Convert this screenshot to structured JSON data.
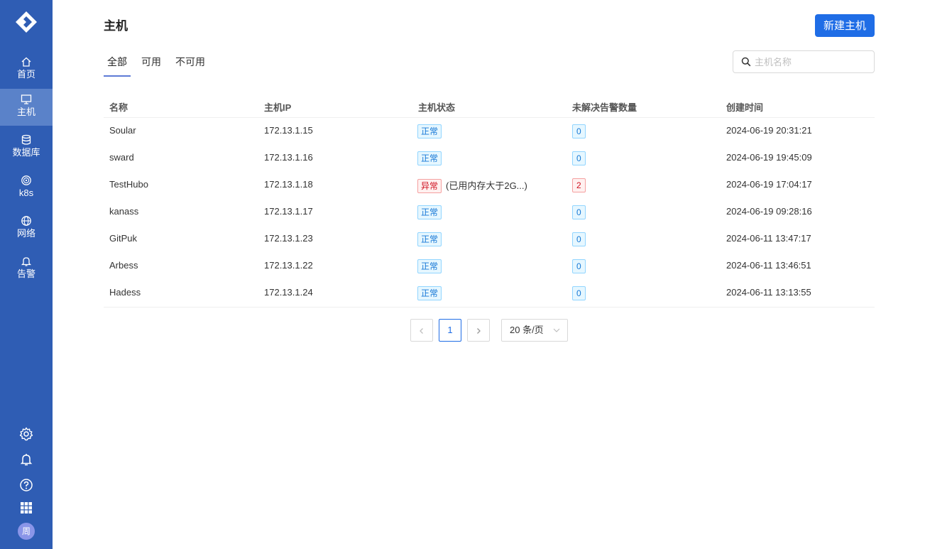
{
  "sidebar": {
    "items": [
      {
        "label": "首页",
        "icon": "home-icon"
      },
      {
        "label": "主机",
        "icon": "monitor-icon",
        "active": true
      },
      {
        "label": "数据库",
        "icon": "database-icon"
      },
      {
        "label": "k8s",
        "icon": "k8s-icon"
      },
      {
        "label": "网络",
        "icon": "globe-icon"
      },
      {
        "label": "告警",
        "icon": "bell-icon"
      }
    ],
    "bottom_icons": [
      "gear-icon",
      "bell-icon",
      "help-icon",
      "apps-grid-icon"
    ],
    "avatar_text": "周"
  },
  "header": {
    "title": "主机",
    "new_button": "新建主机"
  },
  "tabs": [
    {
      "label": "全部",
      "active": true
    },
    {
      "label": "可用"
    },
    {
      "label": "不可用"
    }
  ],
  "search": {
    "placeholder": "主机名称",
    "value": ""
  },
  "table": {
    "columns": [
      "名称",
      "主机IP",
      "主机状态",
      "未解决告警数量",
      "创建时间"
    ],
    "rows": [
      {
        "name": "Soular",
        "ip": "172.13.1.15",
        "status": "正常",
        "status_type": "ok",
        "note": "",
        "alerts": "0",
        "created": "2024-06-19 20:31:21"
      },
      {
        "name": "sward",
        "ip": "172.13.1.16",
        "status": "正常",
        "status_type": "ok",
        "note": "",
        "alerts": "0",
        "created": "2024-06-19 19:45:09"
      },
      {
        "name": "TestHubo",
        "ip": "172.13.1.18",
        "status": "异常",
        "status_type": "err",
        "note": "(已用内存大于2G...)",
        "alerts": "2",
        "created": "2024-06-19 17:04:17"
      },
      {
        "name": "kanass",
        "ip": "172.13.1.17",
        "status": "正常",
        "status_type": "ok",
        "note": "",
        "alerts": "0",
        "created": "2024-06-19 09:28:16"
      },
      {
        "name": "GitPuk",
        "ip": "172.13.1.23",
        "status": "正常",
        "status_type": "ok",
        "note": "",
        "alerts": "0",
        "created": "2024-06-11 13:47:17"
      },
      {
        "name": "Arbess",
        "ip": "172.13.1.22",
        "status": "正常",
        "status_type": "ok",
        "note": "",
        "alerts": "0",
        "created": "2024-06-11 13:46:51"
      },
      {
        "name": "Hadess",
        "ip": "172.13.1.24",
        "status": "正常",
        "status_type": "ok",
        "note": "",
        "alerts": "0",
        "created": "2024-06-11 13:13:55"
      }
    ]
  },
  "pagination": {
    "current_page": "1",
    "page_size_label": "20 条/页"
  },
  "colors": {
    "sidebar_bg": "#2f5db4",
    "sidebar_active": "#5a82c9",
    "primary": "#1f6de6",
    "ok_tag": "#1677d6",
    "err_tag": "#cf1322"
  }
}
